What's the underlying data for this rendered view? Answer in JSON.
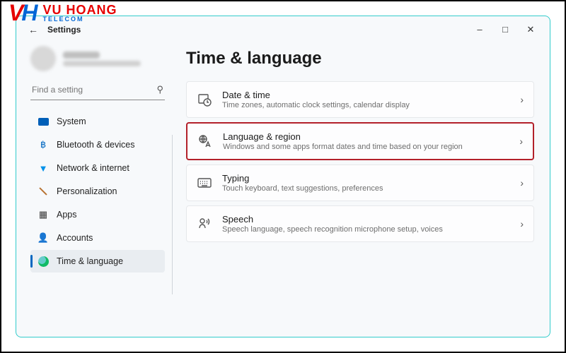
{
  "watermark": {
    "brand_main": "VU HOANG",
    "brand_sub": "TELECOM"
  },
  "window": {
    "title": "Settings",
    "search_placeholder": "Find a setting"
  },
  "nav": {
    "items": [
      {
        "label": "System"
      },
      {
        "label": "Bluetooth & devices"
      },
      {
        "label": "Network & internet"
      },
      {
        "label": "Personalization"
      },
      {
        "label": "Apps"
      },
      {
        "label": "Accounts"
      },
      {
        "label": "Time & language"
      }
    ]
  },
  "page": {
    "title": "Time & language",
    "cards": [
      {
        "title": "Date & time",
        "sub": "Time zones, automatic clock settings, calendar display"
      },
      {
        "title": "Language & region",
        "sub": "Windows and some apps format dates and time based on your region"
      },
      {
        "title": "Typing",
        "sub": "Touch keyboard, text suggestions, preferences"
      },
      {
        "title": "Speech",
        "sub": "Speech language, speech recognition microphone setup, voices"
      }
    ]
  }
}
